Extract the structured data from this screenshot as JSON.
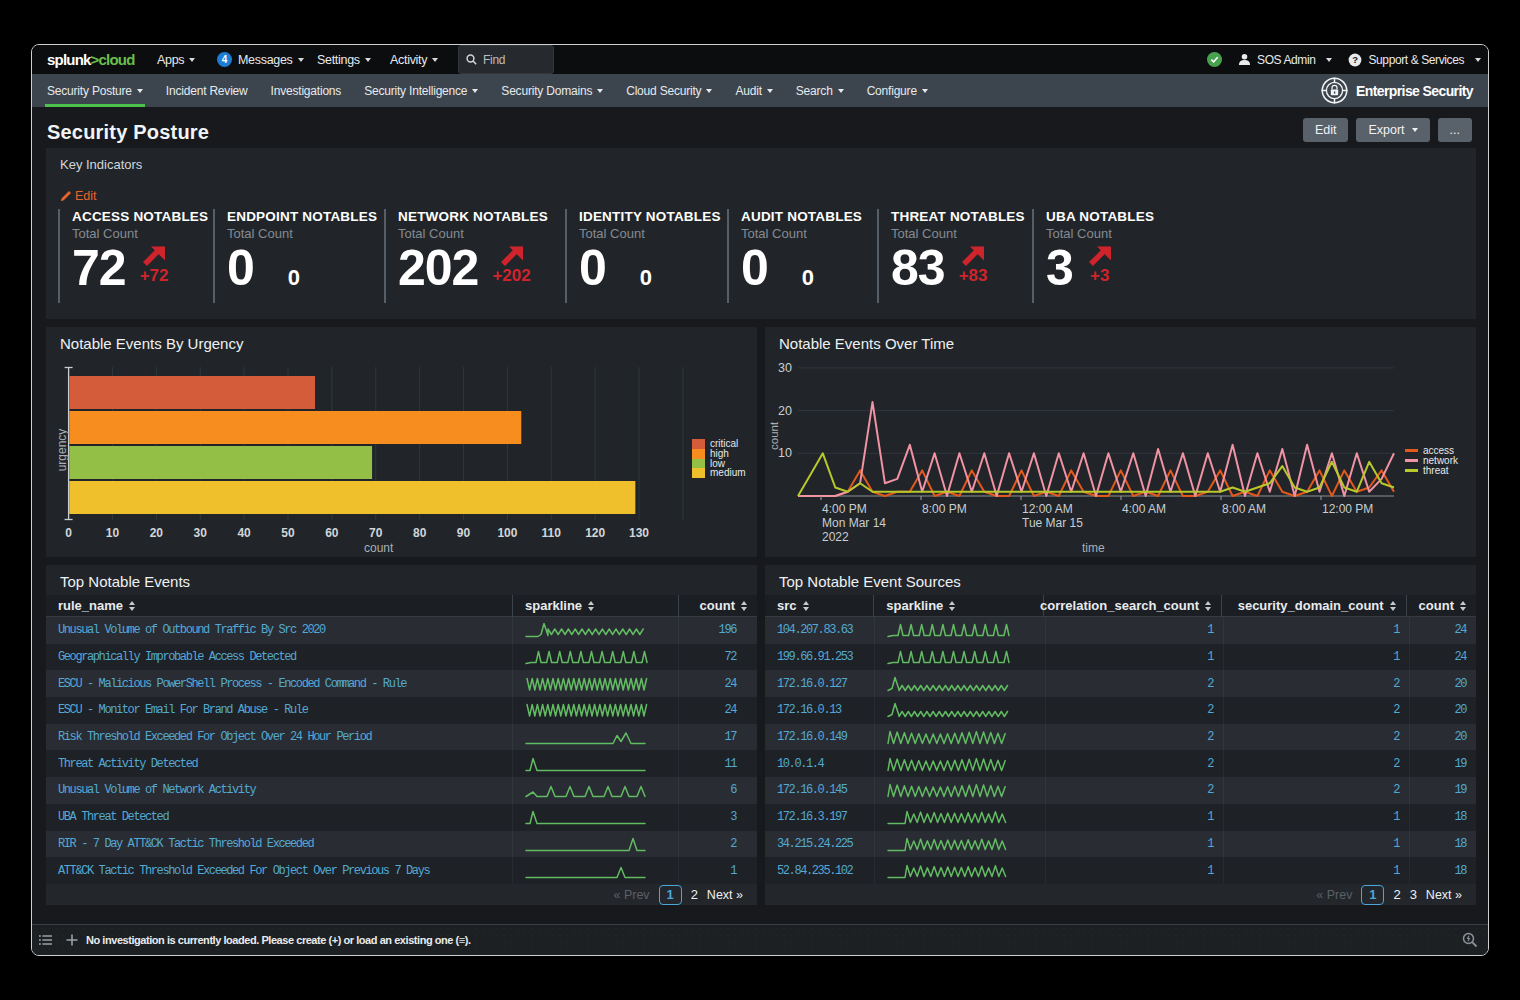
{
  "topnav": {
    "logo": {
      "part1": "splunk",
      "part2": ">",
      "part3": "cloud"
    },
    "items": [
      {
        "label": "Apps",
        "caret": true
      },
      {
        "label": "Messages",
        "caret": true,
        "badge": "4"
      },
      {
        "label": "Settings",
        "caret": true
      },
      {
        "label": "Activity",
        "caret": true
      }
    ],
    "find_placeholder": "Find",
    "user": "SOS Admin",
    "support": "Support & Services"
  },
  "appbar": {
    "items": [
      {
        "label": "Security Posture",
        "caret": true,
        "active": true
      },
      {
        "label": "Incident Review",
        "caret": false,
        "active": false
      },
      {
        "label": "Investigations",
        "caret": false,
        "active": false
      },
      {
        "label": "Security Intelligence",
        "caret": true,
        "active": false
      },
      {
        "label": "Security Domains",
        "caret": true,
        "active": false
      },
      {
        "label": "Cloud Security",
        "caret": true,
        "active": false
      },
      {
        "label": "Audit",
        "caret": true,
        "active": false
      },
      {
        "label": "Search",
        "caret": true,
        "active": false
      },
      {
        "label": "Configure",
        "caret": true,
        "active": false
      }
    ],
    "brand": "Enterprise Security"
  },
  "header": {
    "title": "Security Posture",
    "edit_label": "Edit",
    "export_label": "Export",
    "more_label": "..."
  },
  "key_indicators": {
    "title": "Key Indicators",
    "edit_label": "Edit",
    "kpis": [
      {
        "title": "ACCESS NOTABLES",
        "subtitle": "Total Count",
        "value": "72",
        "delta": "+72",
        "trend": "up",
        "left": 12
      },
      {
        "title": "ENDPOINT NOTABLES",
        "subtitle": "Total Count",
        "value": "0",
        "delta": "0",
        "trend": "flat",
        "left": 167
      },
      {
        "title": "NETWORK NOTABLES",
        "subtitle": "Total Count",
        "value": "202",
        "delta": "+202",
        "trend": "up",
        "left": 338
      },
      {
        "title": "IDENTITY NOTABLES",
        "subtitle": "Total Count",
        "value": "0",
        "delta": "0",
        "trend": "flat",
        "left": 519
      },
      {
        "title": "AUDIT NOTABLES",
        "subtitle": "Total Count",
        "value": "0",
        "delta": "0",
        "trend": "flat",
        "left": 681
      },
      {
        "title": "THREAT NOTABLES",
        "subtitle": "Total Count",
        "value": "83",
        "delta": "+83",
        "trend": "up",
        "left": 831
      },
      {
        "title": "UBA NOTABLES",
        "subtitle": "Total Count",
        "value": "3",
        "delta": "+3",
        "trend": "up",
        "left": 986
      }
    ],
    "delta_color": "#d0242c"
  },
  "chart_data": [
    {
      "type": "bar",
      "title": "Notable Events By Urgency",
      "orientation": "horizontal",
      "categories": [
        "critical",
        "high",
        "low",
        "medium"
      ],
      "values": [
        56,
        103,
        69,
        129
      ],
      "colors": [
        "#d55c3a",
        "#f78c1f",
        "#93bf47",
        "#f0c02c"
      ],
      "xlabel": "count",
      "ylabel": "urgency",
      "xlim": [
        0,
        140
      ],
      "xticks": [
        0,
        10,
        20,
        30,
        40,
        50,
        60,
        70,
        80,
        90,
        100,
        110,
        120,
        130
      ],
      "legend": [
        "critical",
        "high",
        "low",
        "medium"
      ],
      "legend_position": "right",
      "grid": "vertical"
    },
    {
      "type": "line",
      "title": "Notable Events Over Time",
      "xlabel": "time",
      "ylabel": "count",
      "ylim": [
        0,
        32
      ],
      "yticks": [
        10,
        20,
        30
      ],
      "x_tick_labels": [
        {
          "label": "4:00 PM",
          "sublabels": [
            "Mon Mar 14",
            "2022"
          ],
          "f": 0.0386
        },
        {
          "label": "8:00 PM",
          "sublabels": [],
          "f": 0.2064
        },
        {
          "label": "12:00 AM",
          "sublabels": [
            "Tue Mar 15"
          ],
          "f": 0.3742
        },
        {
          "label": "4:00 AM",
          "sublabels": [],
          "f": 0.5419
        },
        {
          "label": "8:00 AM",
          "sublabels": [],
          "f": 0.7097
        },
        {
          "label": "12:00 PM",
          "sublabels": [],
          "f": 0.8775
        }
      ],
      "legend_position": "right",
      "series": [
        {
          "name": "access",
          "color": "#e2591c",
          "values": [
            0,
            0,
            0,
            0,
            1,
            6,
            1,
            0,
            1,
            1,
            6,
            0,
            1,
            0,
            6,
            1,
            0,
            0,
            6,
            0,
            1,
            0,
            6,
            1,
            0,
            0,
            6,
            0,
            1,
            0,
            6,
            0,
            0,
            1,
            6,
            0,
            1,
            0,
            6,
            1,
            0,
            1,
            6,
            0,
            6,
            1,
            2,
            6,
            1
          ]
        },
        {
          "name": "network",
          "color": "#f093a4",
          "values": [
            0,
            0,
            0,
            0,
            1,
            3,
            22,
            3,
            4,
            12,
            1,
            10,
            0,
            10,
            1,
            10,
            0,
            10,
            1,
            10,
            0,
            10,
            1,
            10,
            0,
            10,
            1,
            10,
            0,
            11,
            1,
            10,
            0,
            10,
            1,
            12,
            0,
            10,
            1,
            11,
            0,
            12,
            1,
            10,
            0,
            10,
            1,
            4,
            10
          ]
        },
        {
          "name": "threat",
          "color": "#b8c92b",
          "values": [
            0,
            5,
            10,
            2,
            1,
            3,
            1,
            1,
            1,
            1,
            1,
            1,
            1,
            1,
            1,
            1,
            1,
            1,
            1,
            1,
            1,
            1,
            1,
            1,
            1,
            1,
            1,
            1,
            1,
            1,
            1,
            1,
            1,
            1,
            1,
            2,
            1,
            2,
            3,
            7,
            2,
            1,
            2,
            8,
            2,
            1,
            8,
            3,
            2
          ]
        }
      ]
    }
  ],
  "top_notable_events": {
    "title": "Top Notable Events",
    "columns": [
      "rule_name",
      "sparkline",
      "count"
    ],
    "rows": [
      {
        "rule_name": "Unusual Volume of Outbound Traffic By Src 2020",
        "sparkline": "spike_wave",
        "count": "196"
      },
      {
        "rule_name": "Geographically Improbable Access Detected",
        "sparkline": "regular_peaks",
        "count": "72"
      },
      {
        "rule_name": "ESCU - Malicious PowerShell Process - Encoded Command - Rule",
        "sparkline": "dense_saw",
        "count": "24"
      },
      {
        "rule_name": "ESCU - Monitor Email For Brand Abuse - Rule",
        "sparkline": "dense_saw",
        "count": "24"
      },
      {
        "rule_name": "Risk Threshold Exceeded For Object Over 24 Hour Period",
        "sparkline": "flat_late_bumps",
        "count": "17"
      },
      {
        "rule_name": "Threat Activity Detected",
        "sparkline": "early_spike_flat",
        "count": "11"
      },
      {
        "rule_name": "Unusual Volume of Network Activity",
        "sparkline": "spaced_peaks",
        "count": "6"
      },
      {
        "rule_name": "UBA Threat Detected",
        "sparkline": "early_spike_flat",
        "count": "3"
      },
      {
        "rule_name": "RIR - 7 Day ATT&CK Tactic Threshold Exceeded",
        "sparkline": "flat_end_spike",
        "count": "2"
      },
      {
        "rule_name": "ATT&CK Tactic Threshold Exceeded For Object Over Previous 7 Days",
        "sparkline": "flat_mid_bump",
        "count": "1"
      }
    ],
    "pager": {
      "prev": "« Prev",
      "pages": [
        "1",
        "2"
      ],
      "current": "1",
      "next": "Next »"
    }
  },
  "top_notable_event_sources": {
    "title": "Top Notable Event Sources",
    "columns": [
      "src",
      "sparkline",
      "correlation_search_count",
      "security_domain_count",
      "count"
    ],
    "rows": [
      {
        "src": "104.207.83.63",
        "sparkline": "regular_peaks",
        "correlation_search_count": "1",
        "security_domain_count": "1",
        "count": "24"
      },
      {
        "src": "199.66.91.253",
        "sparkline": "regular_peaks",
        "correlation_search_count": "1",
        "security_domain_count": "1",
        "count": "24"
      },
      {
        "src": "172.16.0.127",
        "sparkline": "spike_ripple",
        "correlation_search_count": "2",
        "security_domain_count": "2",
        "count": "20"
      },
      {
        "src": "172.16.0.13",
        "sparkline": "spike_ripple",
        "correlation_search_count": "2",
        "security_domain_count": "2",
        "count": "20"
      },
      {
        "src": "172.16.0.149",
        "sparkline": "dense_peaks",
        "correlation_search_count": "2",
        "security_domain_count": "2",
        "count": "20"
      },
      {
        "src": "10.0.1.4",
        "sparkline": "dense_peaks",
        "correlation_search_count": "2",
        "security_domain_count": "2",
        "count": "19"
      },
      {
        "src": "172.16.0.145",
        "sparkline": "dense_peaks",
        "correlation_search_count": "2",
        "security_domain_count": "2",
        "count": "19"
      },
      {
        "src": "172.16.3.197",
        "sparkline": "flat_then_dense",
        "correlation_search_count": "1",
        "security_domain_count": "1",
        "count": "18"
      },
      {
        "src": "34.215.24.225",
        "sparkline": "flat_then_dense",
        "correlation_search_count": "1",
        "security_domain_count": "1",
        "count": "18"
      },
      {
        "src": "52.84.235.102",
        "sparkline": "flat_then_dense",
        "correlation_search_count": "1",
        "security_domain_count": "1",
        "count": "18"
      }
    ],
    "pager": {
      "prev": "« Prev",
      "pages": [
        "1",
        "2",
        "3"
      ],
      "current": "1",
      "next": "Next »"
    }
  },
  "sparkline_color": "#62ba62",
  "investigation_bar": {
    "text": "No investigation is currently loaded. Please create (+) or load an existing one (≡)."
  }
}
